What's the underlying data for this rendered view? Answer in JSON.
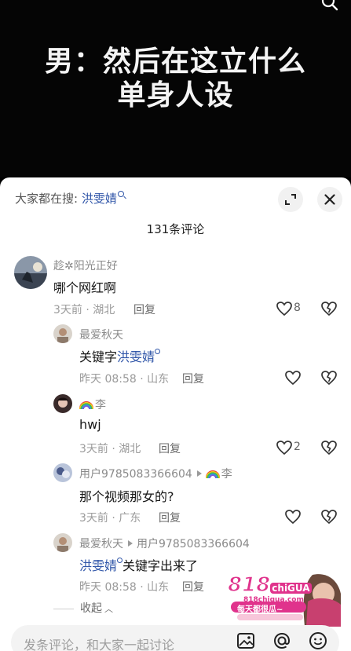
{
  "video": {
    "caption_line1": "男：然后在这立什么",
    "caption_line2": "单身人设"
  },
  "panel": {
    "search_prefix": "大家都在搜:",
    "search_keyword": "洪雯婧",
    "comment_count": "131条评论"
  },
  "comments": [
    {
      "user": "趁✲阳光正好",
      "text": "哪个网红啊",
      "time_loc": "3天前 · 湖北",
      "reply": "回复",
      "likes": "8"
    },
    {
      "user": "最爱秋天",
      "text_prefix": "关键字",
      "text_keyword": "洪雯婧",
      "time_loc": "昨天 08:58 · 山东",
      "reply": "回复",
      "likes": ""
    },
    {
      "user": "李",
      "text": "hwj",
      "time_loc": "3天前 · 湖北",
      "reply": "回复",
      "likes": "2"
    },
    {
      "user": "用户9785083366604",
      "reply_to": "李",
      "text": "那个视频那女的?",
      "time_loc": "3天前 · 广东",
      "reply": "回复",
      "likes": ""
    },
    {
      "user": "最爱秋天",
      "reply_to": "用户9785083366604",
      "text_keyword": "洪雯婧",
      "text_suffix": "关键字出来了",
      "time_loc": "昨天 08:58 · 山东",
      "reply": "回复",
      "likes": ""
    }
  ],
  "collapse_label": "收起",
  "promo": {
    "brand_818": "818",
    "brand_chigua": "chiGUA",
    "url": "818chigua.com",
    "slogan": "每天都很瓜~"
  },
  "input": {
    "placeholder": "发条评论，和大家一起讨论"
  },
  "icons": {
    "top_right": "search-icon",
    "expand": "expand-icon",
    "close": "close-icon",
    "image": "image-icon",
    "mention": "at-icon",
    "emoji": "emoji-icon"
  },
  "colors": {
    "keyword_blue": "#2f55a8",
    "promo_pink": "#e0338c"
  }
}
